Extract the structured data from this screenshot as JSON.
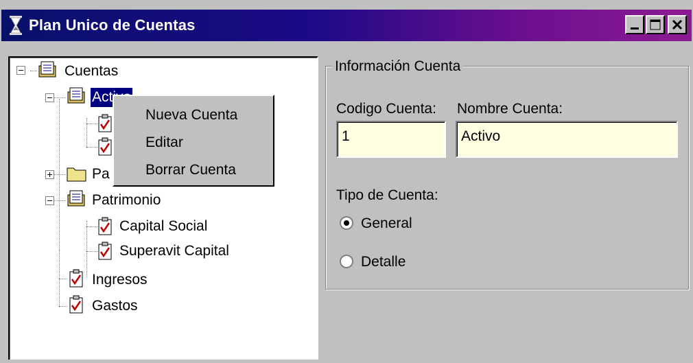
{
  "window": {
    "title": "Plan Unico de Cuentas",
    "controls": [
      "minimize",
      "maximize",
      "close"
    ],
    "app_icon": "hourglass-icon"
  },
  "tree": {
    "root": {
      "label": "Cuentas"
    },
    "activo": {
      "label": "Activo"
    },
    "pasivo_partial": {
      "label": "Pa"
    },
    "patrimonio": {
      "label": "Patrimonio"
    },
    "capital_social": {
      "label": "Capital Social"
    },
    "superavit": {
      "label": "Superavit Capital"
    },
    "ingresos": {
      "label": "Ingresos"
    },
    "gastos": {
      "label": "Gastos"
    }
  },
  "context_menu": {
    "items": [
      "Nueva Cuenta",
      "Editar",
      "Borrar Cuenta"
    ]
  },
  "info": {
    "group_title": "Información Cuenta",
    "codigo_label": "Codigo Cuenta:",
    "codigo_value": "1",
    "nombre_label": "Nombre Cuenta:",
    "nombre_value": "Activo",
    "tipo_label": "Tipo de Cuenta:",
    "options": [
      "General",
      "Detalle"
    ],
    "selected_option": "General"
  },
  "colors": {
    "title_gradient_start": "#08106a",
    "title_gradient_end": "#8c1b92",
    "selection": "#000080",
    "field_bg": "#ffffe1",
    "face": "#c0c0c0"
  }
}
